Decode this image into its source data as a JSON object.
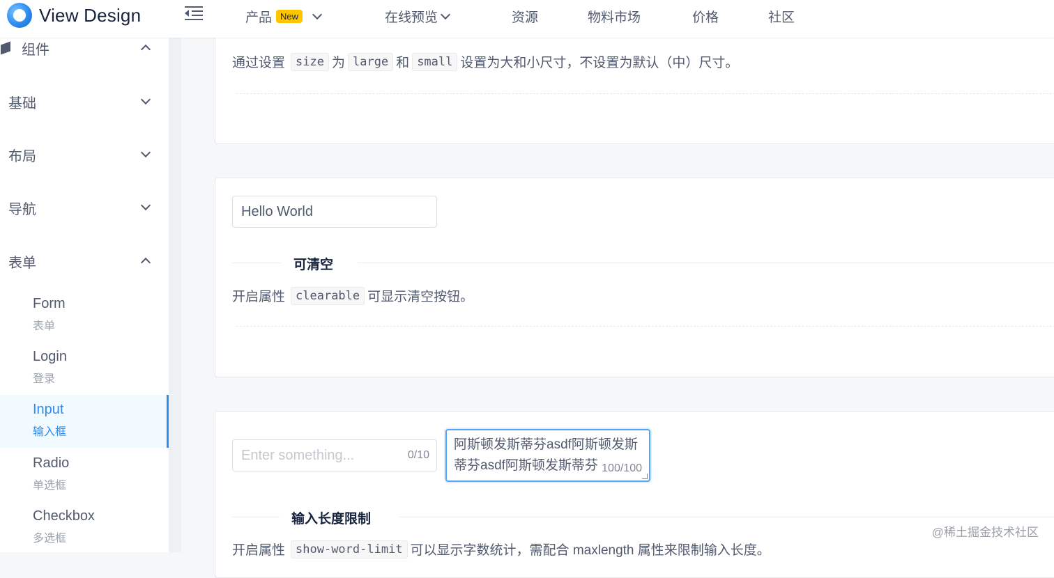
{
  "header": {
    "logo_text": "View Design",
    "nav": [
      {
        "label": "产品",
        "badge": "New"
      },
      {
        "label": "在线预览"
      },
      {
        "label": "资源"
      },
      {
        "label": "物料市场"
      },
      {
        "label": "价格"
      },
      {
        "label": "社区"
      }
    ]
  },
  "sidebar": {
    "groups": [
      "组件",
      "基础",
      "布局",
      "导航",
      "表单"
    ],
    "items": [
      {
        "title": "Form",
        "subtitle": "表单"
      },
      {
        "title": "Login",
        "subtitle": "登录"
      },
      {
        "title": "Input",
        "subtitle": "输入框"
      },
      {
        "title": "Radio",
        "subtitle": "单选框"
      },
      {
        "title": "Checkbox",
        "subtitle": "多选框"
      }
    ]
  },
  "content": {
    "size_section": {
      "prefix": "通过设置",
      "code_size": "size",
      "word_wei": "为",
      "code_large": "large",
      "word_he": "和",
      "code_small": "small",
      "suffix": "设置为大和小尺寸，不设置为默认（中）尺寸。"
    },
    "clearable_section": {
      "input_value": "Hello World",
      "title": "可清空",
      "prefix": "开启属性",
      "code": "clearable",
      "suffix": "可显示清空按钮。"
    },
    "limit_section": {
      "input_placeholder": "Enter something...",
      "input_counter": "0/10",
      "textarea_value": "阿斯顿发斯蒂芬asdf阿斯顿发斯蒂芬asdf阿斯顿发斯蒂芬",
      "textarea_counter": "100/100",
      "title": "输入长度限制",
      "prefix": "开启属性",
      "code": "show-word-limit",
      "suffix": "可以显示字数统计，需配合 maxlength 属性来限制输入长度。"
    }
  },
  "watermark": "@稀土掘金技术社区"
}
